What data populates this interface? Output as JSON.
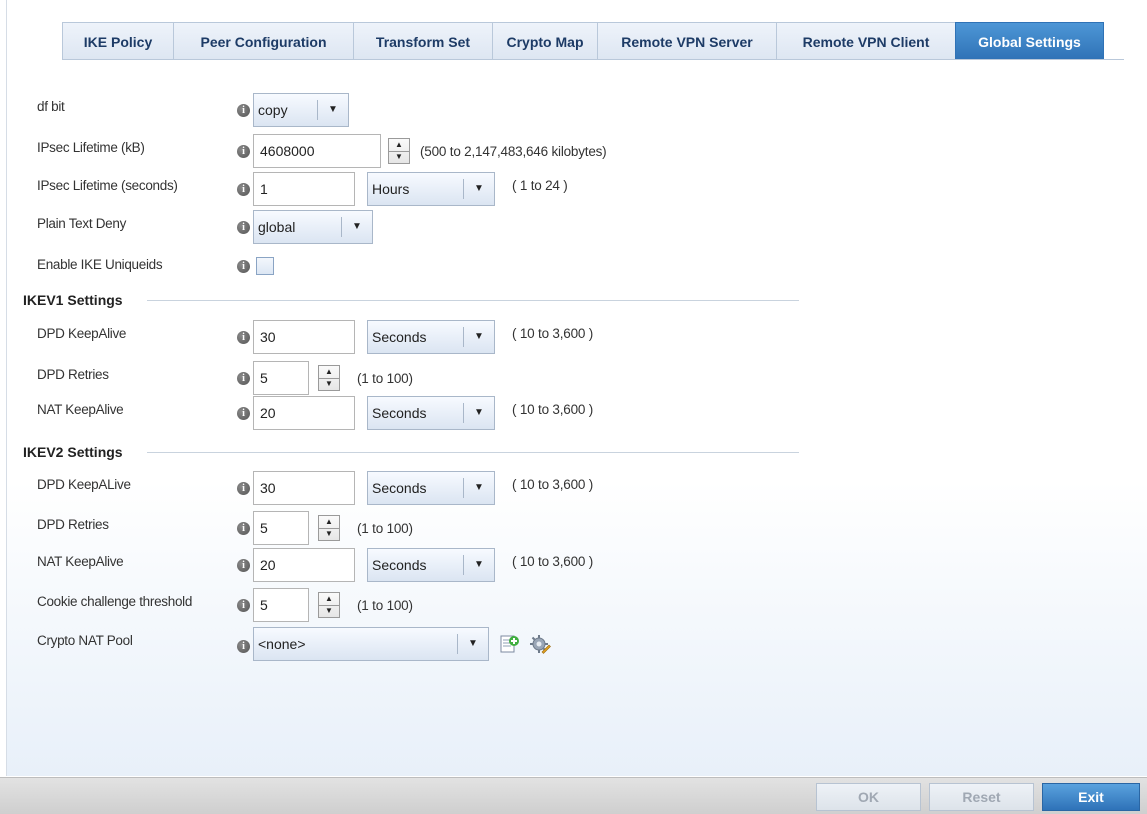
{
  "tabs": [
    {
      "label": "IKE Policy"
    },
    {
      "label": "Peer Configuration"
    },
    {
      "label": "Transform Set"
    },
    {
      "label": "Crypto Map"
    },
    {
      "label": "Remote VPN Server"
    },
    {
      "label": "Remote VPN Client"
    },
    {
      "label": "Global Settings",
      "active": true
    }
  ],
  "general": {
    "df_bit": {
      "label": "df bit",
      "value": "copy"
    },
    "ipsec_lifetime_kb": {
      "label": "IPsec Lifetime (kB)",
      "value": "4608000",
      "hint": "(500 to 2,147,483,646 kilobytes)"
    },
    "ipsec_lifetime_seconds": {
      "label": "IPsec Lifetime (seconds)",
      "value": "1",
      "unit": "Hours",
      "hint": "( 1 to 24 )"
    },
    "plain_text_deny": {
      "label": "Plain Text Deny",
      "value": "global"
    },
    "enable_ike_uniqueids": {
      "label": "Enable IKE Uniqueids",
      "checked": false
    }
  },
  "ikev1": {
    "title": "IKEV1 Settings",
    "dpd_keepalive": {
      "label": "DPD KeepAlive",
      "value": "30",
      "unit": "Seconds",
      "hint": "( 10 to 3,600 )"
    },
    "dpd_retries": {
      "label": "DPD Retries",
      "value": "5",
      "hint": "(1 to 100)"
    },
    "nat_keepalive": {
      "label": "NAT KeepAlive",
      "value": "20",
      "unit": "Seconds",
      "hint": "( 10 to 3,600 )"
    }
  },
  "ikev2": {
    "title": "IKEV2 Settings",
    "dpd_keepalive": {
      "label": "DPD KeepALive",
      "value": "30",
      "unit": "Seconds",
      "hint": "( 10 to 3,600 )"
    },
    "dpd_retries": {
      "label": "DPD Retries",
      "value": "5",
      "hint": "(1 to 100)"
    },
    "nat_keepalive": {
      "label": "NAT KeepAlive",
      "value": "20",
      "unit": "Seconds",
      "hint": "( 10 to 3,600 )"
    },
    "cookie_threshold": {
      "label": "Cookie challenge threshold",
      "value": "5",
      "hint": "(1 to 100)"
    },
    "crypto_nat_pool": {
      "label": "Crypto NAT Pool",
      "value": "<none>"
    }
  },
  "footer": {
    "ok_label": "OK",
    "reset_label": "Reset",
    "exit_label": "Exit"
  },
  "colors": {
    "accent": "#2f72b6",
    "tab_text": "#1d3b66"
  },
  "icons": {
    "info": "info-icon",
    "create": "create-new-icon",
    "edit": "edit-config-icon",
    "dropdown": "chevron-down-icon"
  }
}
